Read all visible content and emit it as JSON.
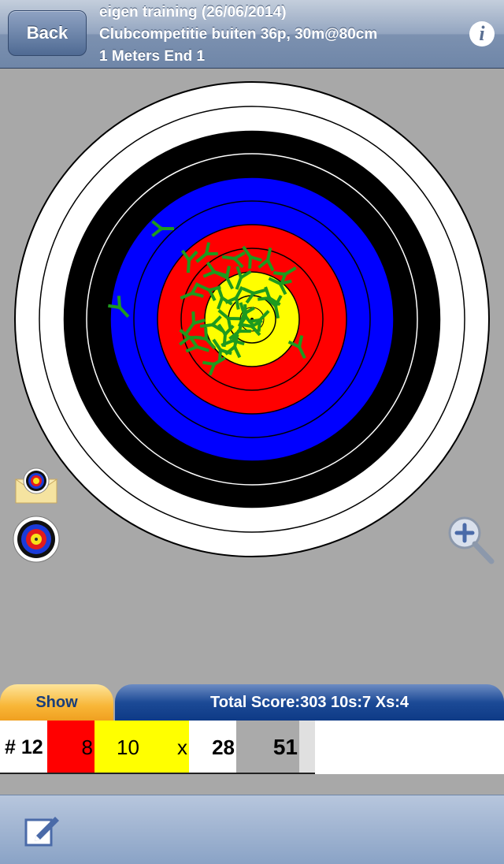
{
  "navbar": {
    "back_label": "Back",
    "line1": "eigen training  (26/06/2014)",
    "line2": "Clubcompetitie buiten 36p, 30m@80cm",
    "line3": "1 Meters End 1",
    "info_label": "i"
  },
  "target": {
    "rings": [
      "white",
      "white",
      "black",
      "black",
      "blue",
      "blue",
      "red",
      "red",
      "yellow",
      "yellow"
    ],
    "colors": {
      "white": "#ffffff",
      "black": "#000000",
      "blue": "#0000ff",
      "red": "#ff0000",
      "yellow": "#ffff00",
      "arrow": "#1e9a1e",
      "background": "#a8a8a8"
    }
  },
  "icons": {
    "mail": "mail-target-icon",
    "target": "target-icon",
    "zoom": "zoom-in-icon",
    "edit": "edit-icon"
  },
  "bottom": {
    "show_label": "Show",
    "total_score": "Total Score:303  10s:7  Xs:4"
  },
  "score_row": {
    "end_number": "# 12",
    "arrow_value_1": "8",
    "arrow_value_2": "10",
    "arrow_value_3": "x",
    "end_total": "28",
    "running_total": "51"
  }
}
